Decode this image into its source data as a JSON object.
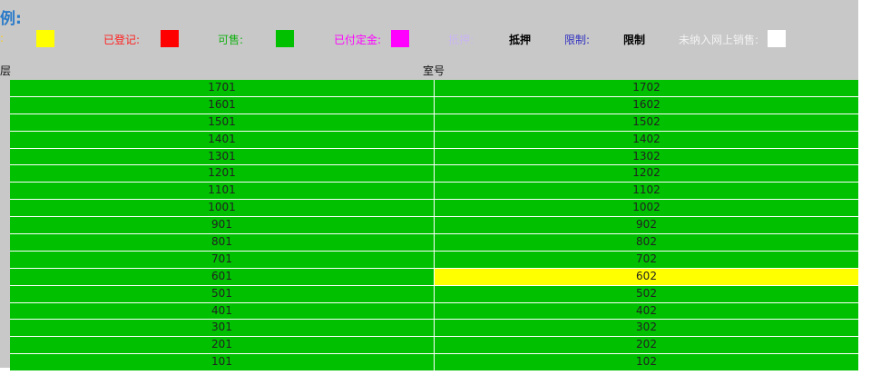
{
  "legend": {
    "title": "例:",
    "items": [
      {
        "label": ":",
        "color": "#ffcc00",
        "swatch": "#ffff00"
      },
      {
        "label": "已登记:",
        "color": "#ff2020",
        "swatch": "#ff0000"
      },
      {
        "label": "可售:",
        "color": "#12b012",
        "swatch": "#00c000"
      },
      {
        "label": "已付定金:",
        "color": "#ff00ff",
        "swatch": "#ff00ff"
      },
      {
        "label": "抵押:",
        "color": "#c9b6f0",
        "text": "抵押"
      },
      {
        "label": "限制:",
        "color": "#3030c0",
        "text": "限制"
      },
      {
        "label": "未纳入网上销售:",
        "color": "#f2f2f2",
        "swatch": "#ffffff"
      }
    ]
  },
  "columns": {
    "floor": "层",
    "room": "室号"
  },
  "colors": {
    "available": "#00c000",
    "pending": "#ffff00"
  },
  "units": [
    {
      "left": "1701",
      "right": "1702",
      "rightStatus": "available"
    },
    {
      "left": "1601",
      "right": "1602",
      "rightStatus": "available"
    },
    {
      "left": "1501",
      "right": "1502",
      "rightStatus": "available"
    },
    {
      "left": "1401",
      "right": "1402",
      "rightStatus": "available"
    },
    {
      "left": "1301",
      "right": "1302",
      "rightStatus": "available"
    },
    {
      "left": "1201",
      "right": "1202",
      "rightStatus": "available"
    },
    {
      "left": "1101",
      "right": "1102",
      "rightStatus": "available"
    },
    {
      "left": "1001",
      "right": "1002",
      "rightStatus": "available"
    },
    {
      "left": "901",
      "right": "902",
      "rightStatus": "available"
    },
    {
      "left": "801",
      "right": "802",
      "rightStatus": "available"
    },
    {
      "left": "701",
      "right": "702",
      "rightStatus": "available"
    },
    {
      "left": "601",
      "right": "602",
      "rightStatus": "pending"
    },
    {
      "left": "501",
      "right": "502",
      "rightStatus": "available"
    },
    {
      "left": "401",
      "right": "402",
      "rightStatus": "available"
    },
    {
      "left": "301",
      "right": "302",
      "rightStatus": "available"
    },
    {
      "left": "201",
      "right": "202",
      "rightStatus": "available"
    },
    {
      "left": "101",
      "right": "102",
      "rightStatus": "available"
    }
  ]
}
